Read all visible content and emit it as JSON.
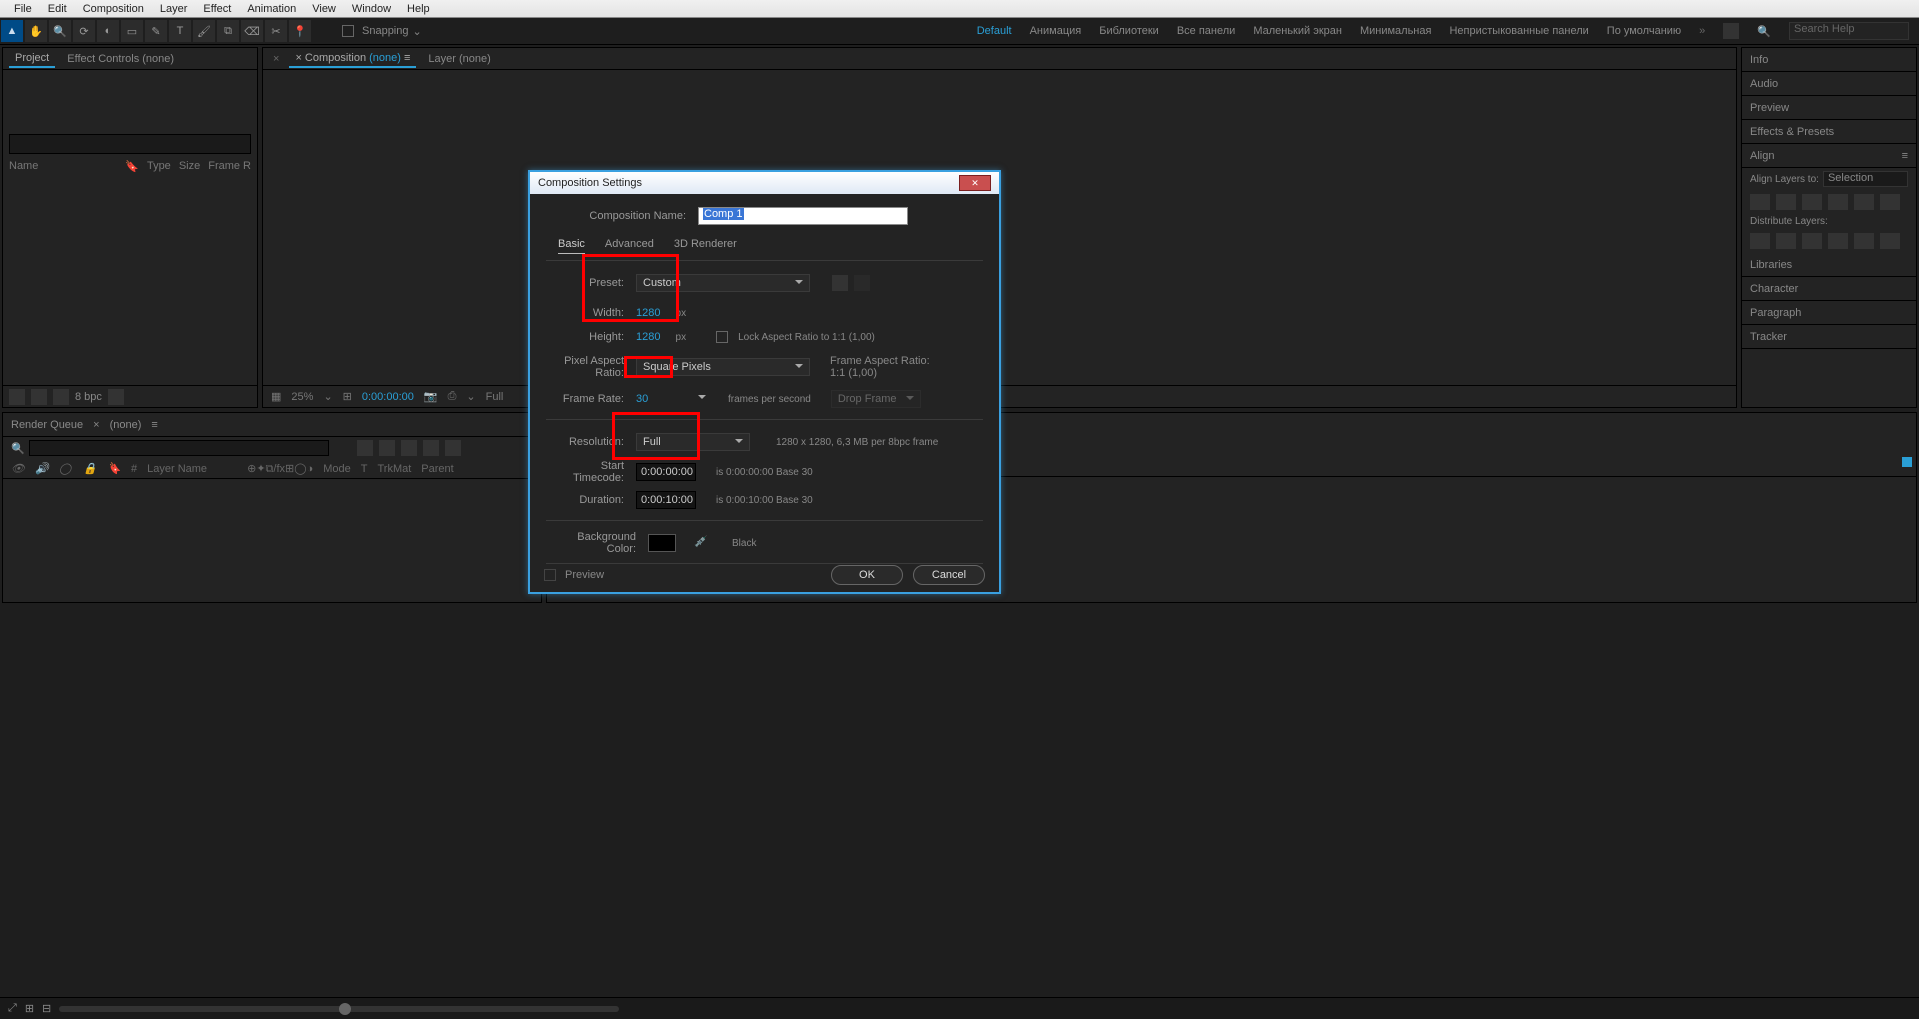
{
  "menubar": [
    "File",
    "Edit",
    "Composition",
    "Layer",
    "Effect",
    "Animation",
    "View",
    "Window",
    "Help"
  ],
  "toolbar": {
    "tools": [
      "select",
      "hand",
      "zoom",
      "orbit",
      "rotate",
      "rect",
      "pen",
      "text",
      "brush",
      "stamp",
      "eraser",
      "roto",
      "puppet"
    ],
    "snapping_label": "Snapping",
    "workspaces": [
      "Default",
      "Анимация",
      "Библиотеки",
      "Все панели",
      "Маленький экран",
      "Минимальная",
      "Непристыкованные панели",
      "По умолчанию"
    ],
    "workspaces_active": 0,
    "search_placeholder": "Search Help"
  },
  "left_panel": {
    "tabs": {
      "project": "Project",
      "effect_controls": "Effect Controls",
      "effect_controls_arg": "(none)"
    },
    "columns": [
      "Name",
      "Type",
      "Size",
      "Frame R"
    ],
    "footer_bpc": "8 bpc"
  },
  "center_panel": {
    "tab_prefix": "Composition",
    "tab_arg": "(none)",
    "layer_tab": "Layer (none)",
    "footer": {
      "zoom": "25%",
      "time": "0:00:00:00",
      "res": "Full"
    }
  },
  "right_panel": {
    "items": [
      "Info",
      "Audio",
      "Preview",
      "Effects & Presets",
      "Align",
      "Libraries",
      "Character",
      "Paragraph",
      "Tracker"
    ],
    "align_to_label": "Align Layers to:",
    "align_to_value": "Selection",
    "distribute_label": "Distribute Layers:"
  },
  "lower": {
    "render_queue_tab": "Render Queue",
    "comp_tab": "(none)",
    "columns": [
      "#",
      "Layer Name",
      "Mode",
      "T",
      "TrkMat",
      "Parent"
    ]
  },
  "dialog": {
    "title": "Composition Settings",
    "name_label": "Composition Name:",
    "name_value": "Comp 1",
    "tabs": [
      "Basic",
      "Advanced",
      "3D Renderer"
    ],
    "preset_label": "Preset:",
    "preset_value": "Custom",
    "width_label": "Width:",
    "width_value": "1280",
    "height_label": "Height:",
    "height_value": "1280",
    "px_suffix": "px",
    "lock_ar_label": "Lock Aspect Ratio to 1:1 (1,00)",
    "par_label": "Pixel Aspect Ratio:",
    "par_value": "Square Pixels",
    "far_label": "Frame Aspect Ratio:",
    "far_value": "1:1 (1,00)",
    "fps_label": "Frame Rate:",
    "fps_value": "30",
    "fps_suffix": "frames per second",
    "drop_frame": "Drop Frame",
    "res_label": "Resolution:",
    "res_value": "Full",
    "res_info": "1280 x 1280, 6,3 MB per 8bpc frame",
    "start_label": "Start Timecode:",
    "start_value": "0:00:00:00",
    "start_info": "is 0:00:00:00  Base 30",
    "dur_label": "Duration:",
    "dur_value": "0:00:10:00",
    "dur_info": "is 0:00:10:00  Base 30",
    "bg_label": "Background Color:",
    "bg_name": "Black",
    "preview_label": "Preview",
    "ok": "OK",
    "cancel": "Cancel"
  }
}
